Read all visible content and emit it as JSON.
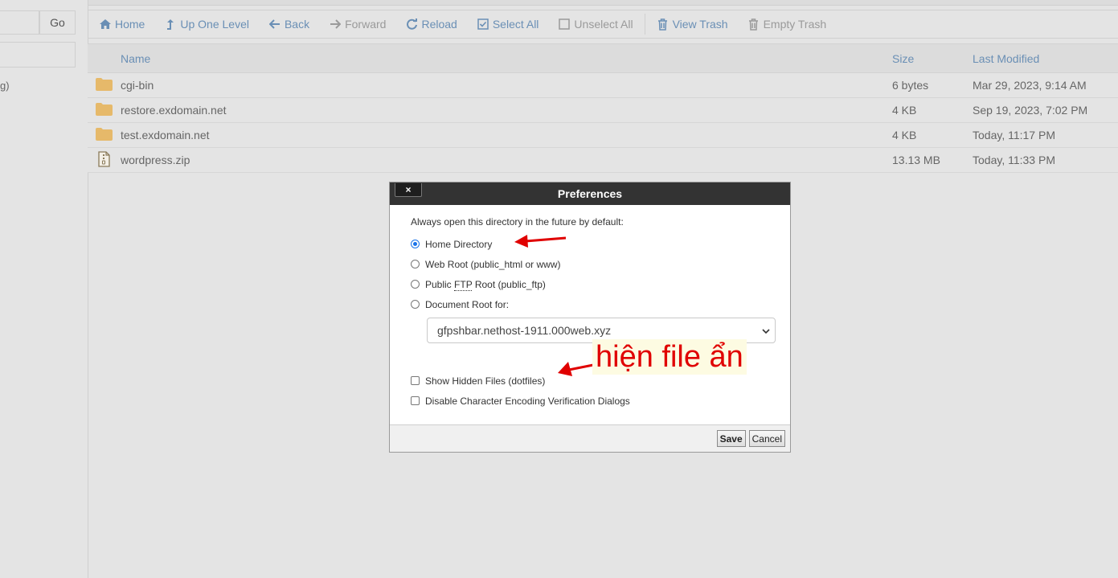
{
  "left_panel": {
    "go_label": "Go",
    "partial_text": "g)"
  },
  "toolbar": {
    "home": "Home",
    "up_one_level": "Up One Level",
    "back": "Back",
    "forward": "Forward",
    "reload": "Reload",
    "select_all": "Select All",
    "unselect_all": "Unselect All",
    "view_trash": "View Trash",
    "empty_trash": "Empty Trash"
  },
  "file_table": {
    "headers": {
      "name": "Name",
      "size": "Size",
      "modified": "Last Modified"
    },
    "rows": [
      {
        "icon": "folder-icon",
        "name": "cgi-bin",
        "size": "6 bytes",
        "modified": "Mar 29, 2023, 9:14 AM"
      },
      {
        "icon": "folder-icon",
        "name": "restore.exdomain.net",
        "size": "4 KB",
        "modified": "Sep 19, 2023, 7:02 PM"
      },
      {
        "icon": "folder-icon",
        "name": "test.exdomain.net",
        "size": "4 KB",
        "modified": "Today, 11:17 PM"
      },
      {
        "icon": "zip-file-icon",
        "name": "wordpress.zip",
        "size": "13.13 MB",
        "modified": "Today, 11:33 PM"
      }
    ]
  },
  "dialog": {
    "title": "Preferences",
    "close_label": "×",
    "description": "Always open this directory in the future by default:",
    "options": {
      "home": "Home Directory",
      "web_root": "Web Root (public_html or www)",
      "ftp_prefix": "Public ",
      "ftp_abbr": "FTP",
      "ftp_suffix": " Root (public_ftp)",
      "doc_root": "Document Root for:"
    },
    "selected_option": "home",
    "domain_select": "gfpshbar.nethost-1911.000web.xyz",
    "show_hidden": "Show Hidden Files (dotfiles)",
    "disable_encoding": "Disable Character Encoding Verification Dialogs",
    "save": "Save",
    "cancel": "Cancel"
  },
  "annotation": {
    "text": "hiện file ẩn",
    "color": "#e00000"
  },
  "colors": {
    "link": "#6a8fb5",
    "folder": "#e6b96a",
    "dialog_title_bg": "#333333"
  }
}
